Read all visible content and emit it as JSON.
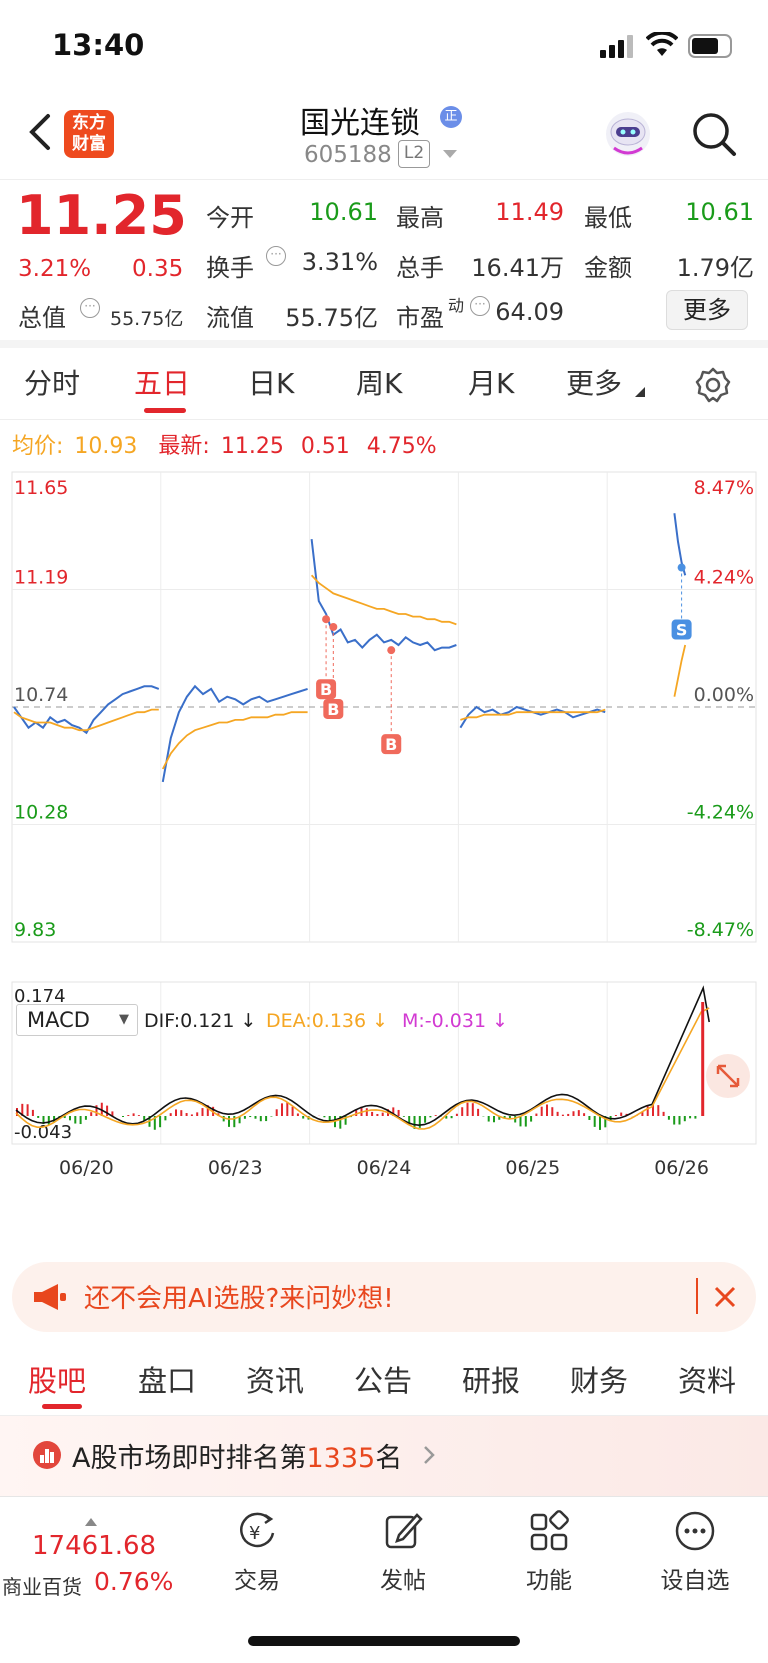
{
  "status_bar": {
    "time": "13:40"
  },
  "header": {
    "logo_line1": "东方",
    "logo_line2": "财富",
    "stock_name": "国光连锁",
    "badge": "正",
    "code": "605188",
    "level": "L2"
  },
  "quote": {
    "price": "11.25",
    "change_pct": "3.21%",
    "change": "0.35",
    "total_mv_label": "总值",
    "total_mv": "55.75亿",
    "open_label": "今开",
    "open": "10.61",
    "high_label": "最高",
    "high": "11.49",
    "low_label": "最低",
    "low": "10.61",
    "turnover_label": "换手",
    "turnover": "3.31%",
    "volume_label": "总手",
    "volume": "16.41万",
    "amount_label": "金额",
    "amount": "1.79亿",
    "float_mv_label": "流值",
    "float_mv": "55.75亿",
    "pe_label": "市盈",
    "pe_sup": "动",
    "pe": "64.09",
    "more_button": "更多"
  },
  "tabs": [
    "分时",
    "五日",
    "日K",
    "周K",
    "月K",
    "更多"
  ],
  "active_tab": "五日",
  "avg_line": {
    "avg_label": "均价:",
    "avg": "10.93",
    "latest_label": "最新:",
    "latest": "11.25",
    "change": "0.51",
    "change_pct": "4.75%"
  },
  "chart_data": {
    "type": "line",
    "title": "",
    "x_labels": [
      "06/20",
      "06/23",
      "06/24",
      "06/25",
      "06/26"
    ],
    "y_left_ticks": [
      "11.65",
      "11.19",
      "10.74",
      "10.28",
      "9.83"
    ],
    "y_right_ticks": [
      "8.47%",
      "4.24%",
      "0.00%",
      "-4.24%",
      "-8.47%"
    ],
    "ylim": [
      9.83,
      11.65
    ],
    "prev_close": 10.74,
    "series": [
      {
        "name": "",
        "color": "#3a6fc9",
        "values": [
          10.74,
          10.7,
          10.66,
          10.68,
          10.66,
          10.7,
          10.68,
          10.69,
          10.67,
          10.66,
          10.64,
          10.69,
          10.72,
          10.75,
          10.77,
          10.79,
          10.8,
          10.81,
          10.82,
          10.82,
          10.81,
          10.45,
          10.62,
          10.72,
          10.78,
          10.82,
          10.79,
          10.81,
          10.76,
          10.78,
          10.77,
          10.75,
          10.77,
          10.78,
          10.76,
          10.77,
          10.78,
          10.79,
          10.8,
          10.81,
          11.39,
          11.15,
          11.1,
          11.02,
          11.04,
          10.99,
          11.0,
          10.97,
          11.0,
          11.02,
          10.99,
          11.0,
          10.98,
          11.01,
          10.99,
          10.98,
          10.99,
          10.96,
          10.97,
          10.97,
          10.98,
          10.66,
          10.71,
          10.74,
          10.72,
          10.73,
          10.71,
          10.72,
          10.74,
          10.73,
          10.72,
          10.71,
          10.72,
          10.73,
          10.72,
          10.7,
          10.71,
          10.72,
          10.73,
          10.72,
          11.49,
          11.38,
          11.3,
          11.25
        ]
      },
      {
        "name": "",
        "color": "#f5a623",
        "values": [
          10.72,
          10.7,
          10.69,
          10.68,
          10.68,
          10.68,
          10.67,
          10.66,
          10.66,
          10.65,
          10.65,
          10.66,
          10.67,
          10.68,
          10.69,
          10.7,
          10.71,
          10.72,
          10.72,
          10.73,
          10.73,
          10.5,
          10.56,
          10.6,
          10.63,
          10.65,
          10.66,
          10.67,
          10.68,
          10.68,
          10.69,
          10.69,
          10.7,
          10.7,
          10.7,
          10.71,
          10.71,
          10.72,
          10.72,
          10.72,
          11.25,
          11.22,
          11.2,
          11.18,
          11.17,
          11.16,
          11.15,
          11.14,
          11.13,
          11.12,
          11.12,
          11.11,
          11.1,
          11.1,
          11.09,
          11.09,
          11.08,
          11.08,
          11.07,
          11.07,
          11.06,
          10.69,
          10.7,
          10.7,
          10.71,
          10.71,
          10.71,
          10.71,
          10.72,
          10.72,
          10.72,
          10.72,
          10.72,
          10.72,
          10.72,
          10.72,
          10.72,
          10.72,
          10.72,
          10.73,
          10.78,
          10.85,
          10.92,
          10.98
        ]
      }
    ],
    "markers": [
      {
        "label": "B",
        "index": 42,
        "value": 11.08
      },
      {
        "label": "B",
        "index": 43,
        "value": 11.05
      },
      {
        "label": "B",
        "index": 51,
        "value": 10.96
      },
      {
        "label": "S",
        "index": 82,
        "value": 11.28
      }
    ],
    "macd": {
      "selector": "MACD",
      "dif_label": "DIF:0.121 ↓",
      "dea_label": "DEA:0.136 ↓",
      "m_label": "M:-0.031 ↓",
      "ymax_label": "0.174",
      "ymin_label": "-0.043",
      "ylim": [
        -0.043,
        0.174
      ]
    }
  },
  "banner": {
    "text": "还不会用AI选股?来问妙想!"
  },
  "subtabs": [
    "股吧",
    "盘口",
    "资讯",
    "公告",
    "研报",
    "财务",
    "资料"
  ],
  "active_subtab": "股吧",
  "rank": {
    "prefix": "A股市场即时排名第",
    "number": "1335",
    "suffix": "名"
  },
  "bottom": {
    "index_value": "17461.68",
    "index_name": "商业百货",
    "index_change": "0.76%",
    "trade": "交易",
    "post": "发帖",
    "function": "功能",
    "watch": "设自选"
  }
}
